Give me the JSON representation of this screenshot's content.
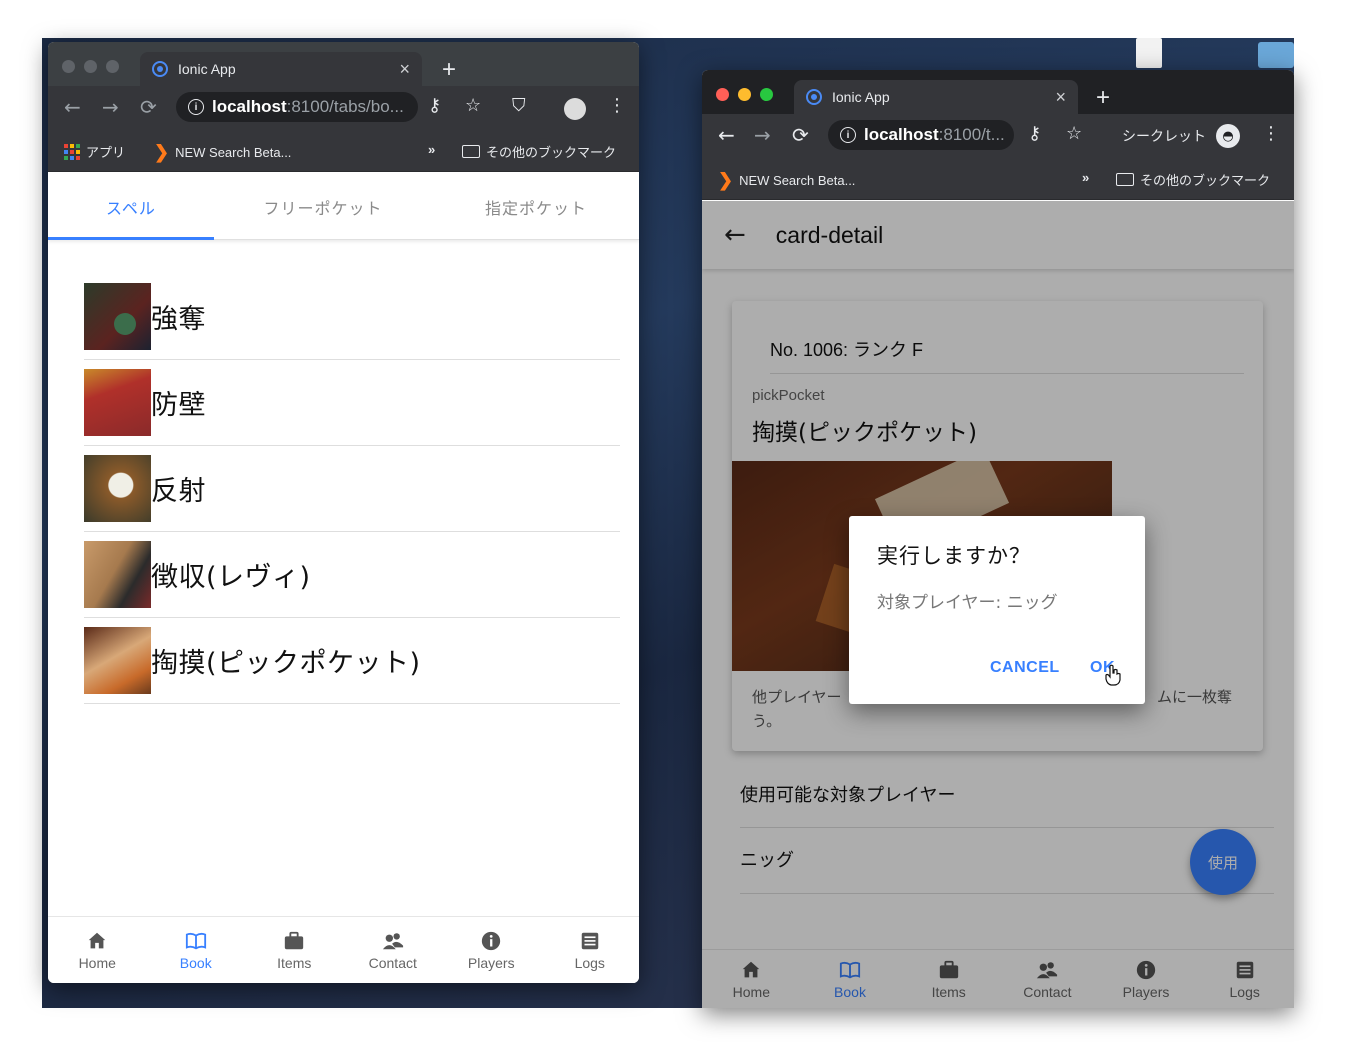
{
  "colors": {
    "accent": "#3880ff",
    "light_red": "#ff5f57",
    "light_yellow": "#febc2e",
    "light_green": "#28c840",
    "light_gray": "#5f6368"
  },
  "window_left": {
    "tab_title": "Ionic App",
    "tab_close": "×",
    "new_tab": "+",
    "url_host": "localhost",
    "url_path": ":8100/tabs/bo...",
    "bookmarks": {
      "apps": "アプリ",
      "search": "NEW Search Beta...",
      "more": "»",
      "other": "その他のブックマーク"
    },
    "segments": [
      "スペル",
      "フリーポケット",
      "指定ポケット"
    ],
    "cards": [
      "強奪",
      "防壁",
      "反射",
      "徴収(レヴィ)",
      "掏摸(ピックポケット)"
    ],
    "tabs": [
      "Home",
      "Book",
      "Items",
      "Contact",
      "Players",
      "Logs"
    ]
  },
  "window_right": {
    "tab_title": "Ionic App",
    "tab_close": "×",
    "new_tab": "+",
    "url_host": "localhost",
    "url_path": ":8100/t...",
    "incognito": "シークレット",
    "bookmarks": {
      "search": "NEW Search Beta...",
      "more": "»",
      "other": "その他のブックマーク"
    },
    "page_title": "card-detail",
    "card": {
      "number": "No. 1006: ランク F",
      "subtitle": "pickPocket",
      "name": "掏摸(ピックポケット)",
      "desc_left": "他プレイヤー",
      "desc_right": "ムに一枚奪",
      "desc_line2": "う。"
    },
    "section_label": "使用可能な対象プレイヤー",
    "player": "ニッグ",
    "fab": "使用",
    "dialog": {
      "title": "実行しますか？",
      "message": "対象プレイヤー: ニッグ",
      "cancel": "CANCEL",
      "ok": "OK"
    },
    "tabs": [
      "Home",
      "Book",
      "Items",
      "Contact",
      "Players",
      "Logs"
    ]
  }
}
